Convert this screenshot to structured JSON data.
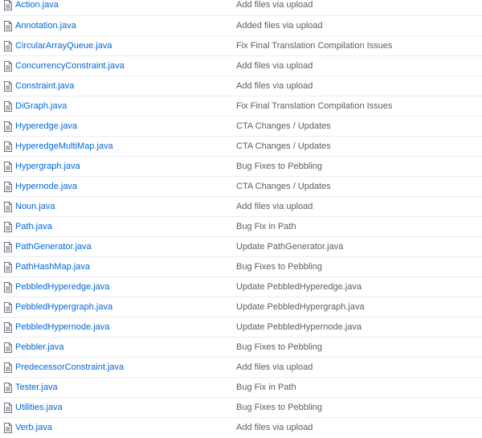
{
  "files": [
    {
      "name": "Action.java",
      "message": "Add files via upload",
      "icon": "file-icon"
    },
    {
      "name": "Annotation.java",
      "message": "Added files via upload",
      "icon": "file-icon"
    },
    {
      "name": "CircularArrayQueue.java",
      "message": "Fix Final Translation Compilation Issues",
      "icon": "file-icon"
    },
    {
      "name": "ConcurrencyConstraint.java",
      "message": "Add files via upload",
      "icon": "file-icon"
    },
    {
      "name": "Constraint.java",
      "message": "Add files via upload",
      "icon": "file-icon"
    },
    {
      "name": "DiGraph.java",
      "message": "Fix Final Translation Compilation Issues",
      "icon": "file-icon"
    },
    {
      "name": "Hyperedge.java",
      "message": "CTA Changes / Updates",
      "icon": "file-icon"
    },
    {
      "name": "HyperedgeMultiMap.java",
      "message": "CTA Changes / Updates",
      "icon": "file-icon"
    },
    {
      "name": "Hypergraph.java",
      "message": "Bug Fixes to Pebbling",
      "icon": "file-icon"
    },
    {
      "name": "Hypernode.java",
      "message": "CTA Changes / Updates",
      "icon": "file-icon"
    },
    {
      "name": "Noun.java",
      "message": "Add files via upload",
      "icon": "file-icon"
    },
    {
      "name": "Path.java",
      "message": "Bug Fix in Path",
      "icon": "file-icon"
    },
    {
      "name": "PathGenerator.java",
      "message": "Update PathGenerator.java",
      "icon": "file-icon"
    },
    {
      "name": "PathHashMap.java",
      "message": "Bug Fixes to Pebbling",
      "icon": "file-icon"
    },
    {
      "name": "PebbledHyperedge.java",
      "message": "Update PebbledHyperedge.java",
      "icon": "file-icon"
    },
    {
      "name": "PebbledHypergraph.java",
      "message": "Update PebbledHypergraph.java",
      "icon": "file-icon"
    },
    {
      "name": "PebbledHypernode.java",
      "message": "Update PebbledHypernode.java",
      "icon": "file-icon"
    },
    {
      "name": "Pebbler.java",
      "message": "Bug Fixes to Pebbling",
      "icon": "file-icon"
    },
    {
      "name": "PredecessorConstraint.java",
      "message": "Add files via upload",
      "icon": "file-icon"
    },
    {
      "name": "Tester.java",
      "message": "Bug Fix in Path",
      "icon": "file-icon"
    },
    {
      "name": "Utilities.java",
      "message": "Bug Fixes to Pebbling",
      "icon": "file-icon"
    },
    {
      "name": "Verb.java",
      "message": "Add files via upload",
      "icon": "file-icon"
    }
  ],
  "colors": {
    "link": "#0366d6",
    "message": "#586069",
    "icon": "#6a737d",
    "divider": "#eaecef"
  }
}
